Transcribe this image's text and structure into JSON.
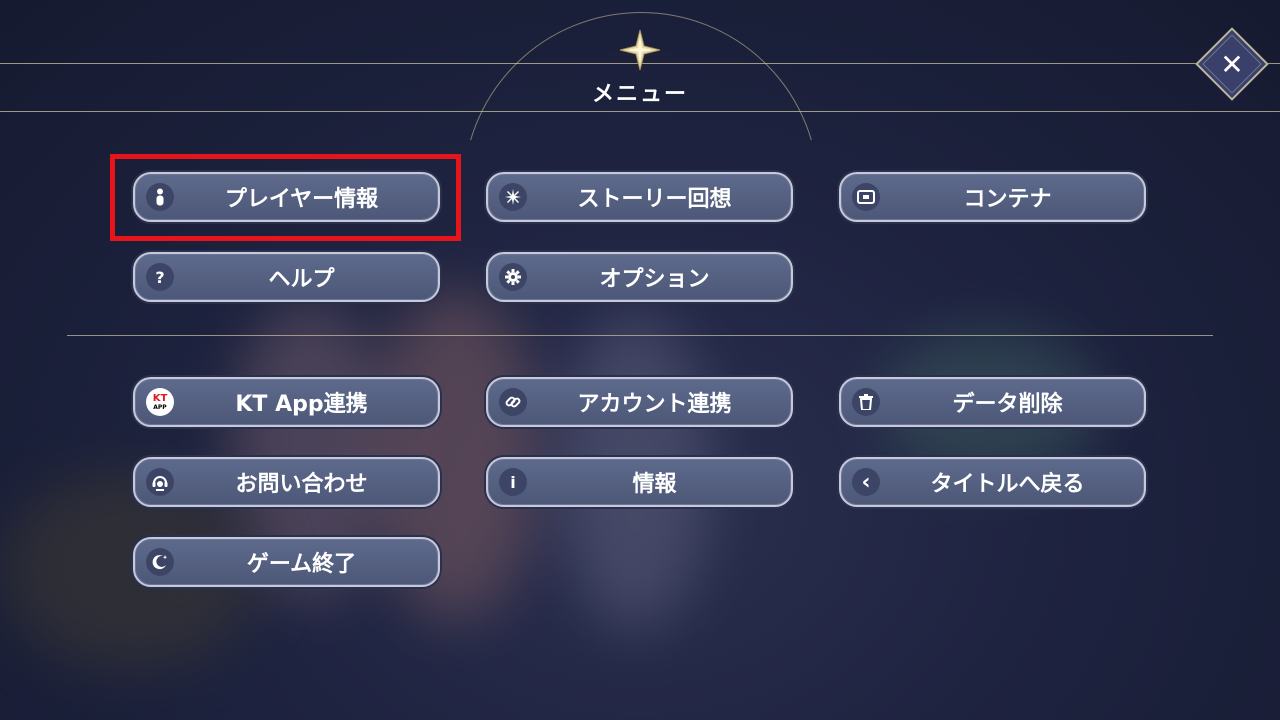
{
  "header": {
    "title": "メニュー"
  },
  "close_button": {
    "symbol": "✕"
  },
  "menu": {
    "items": [
      {
        "label": "プレイヤー情報",
        "icon": "person-icon"
      },
      {
        "label": "ストーリー回想",
        "icon": "sparkle-icon"
      },
      {
        "label": "コンテナ",
        "icon": "container-icon"
      },
      {
        "label": "ヘルプ",
        "icon": "help-icon"
      },
      {
        "label": "オプション",
        "icon": "gear-icon"
      },
      {
        "label": "KT App連携",
        "icon": "kt-app-icon"
      },
      {
        "label": "アカウント連携",
        "icon": "link-icon"
      },
      {
        "label": "データ削除",
        "icon": "trash-icon"
      },
      {
        "label": "お問い合わせ",
        "icon": "support-icon"
      },
      {
        "label": "情報",
        "icon": "info-icon"
      },
      {
        "label": "タイトルへ戻る",
        "icon": "back-icon"
      },
      {
        "label": "ゲーム終了",
        "icon": "moon-icon"
      }
    ]
  },
  "icon_glyphs": {
    "help": "?",
    "info": "i",
    "back": "‹",
    "kt_logo": "KT",
    "kt_app_text": "APP"
  },
  "colors": {
    "accent": "#c9c3a6",
    "button": "#56617f",
    "highlight": "#e8141b"
  }
}
